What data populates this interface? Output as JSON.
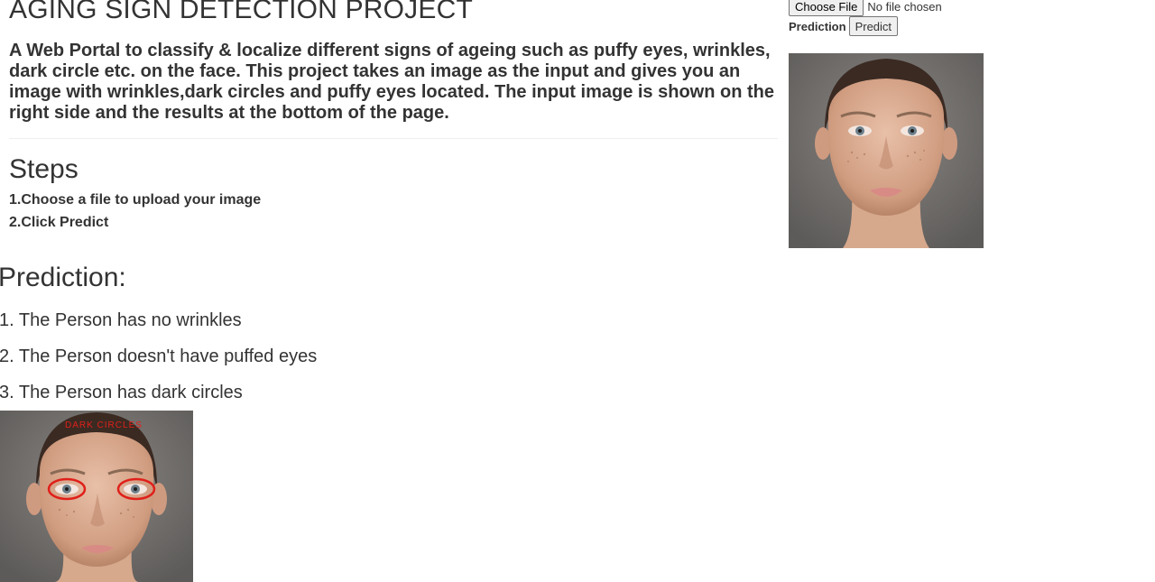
{
  "header": {
    "title": "AGING SIGN DETECTION PROJECT",
    "description": "A Web Portal to classify & localize different signs of ageing such as puffy eyes, wrinkles, dark circle etc. on the face. This project takes an image as the input and gives you an image with wrinkles,dark circles and puffy eyes located. The input image is shown on the right side and the results at the bottom of the page."
  },
  "steps": {
    "heading": "Steps",
    "items": [
      "1.Choose a file to upload your image",
      "2.Click Predict"
    ]
  },
  "upload": {
    "choose_label": "Choose File",
    "file_status": "No file chosen",
    "prediction_label": "Prediction",
    "predict_button": "Predict"
  },
  "prediction": {
    "heading": "Prediction:",
    "results": [
      "1. The Person has no wrinkles",
      "2. The Person doesn't have puffed eyes",
      "3. The Person has dark circles"
    ],
    "annotation_label": "DARK CIRCLES"
  },
  "colors": {
    "text": "#333333",
    "annotation": "#e0201a",
    "background_photo": "#6e6c6a"
  }
}
